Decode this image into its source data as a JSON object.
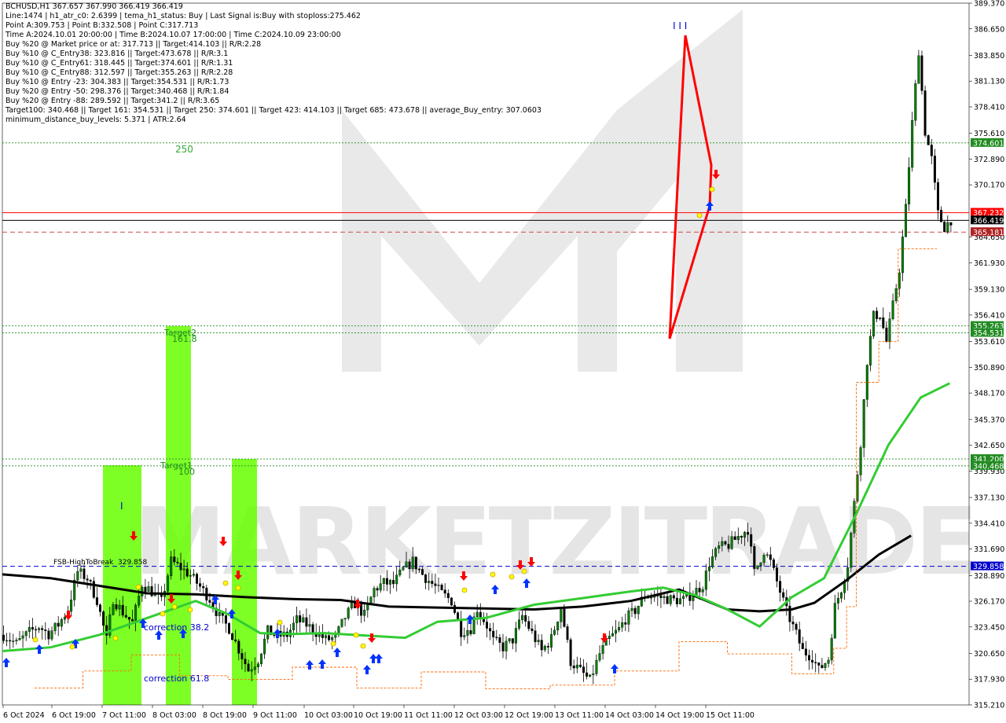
{
  "header": {
    "lines": [
      "BCHUSD,H1  367.657 367.990 366.419 366.419",
      "Line:1474 | h1_atr_c0: 2.6399 | tema_h1_status: Buy | Last Signal is:Buy with stoploss:275.462",
      "Point A:309.753 | Point B:332.508 | Point C:317.713",
      "Time A:2024.10.01 20:00:00 | Time B:2024.10.07 17:00:00 | Time C:2024.10.09 23:00:00",
      "Buy %20 @ Market price or at: 317.713 || Target:414.103 || R/R:2.28",
      "Buy %10 @ C_Entry38: 323.816 || Target:473.678 || R/R:3.1",
      "Buy %10 @ C_Entry61: 318.445 || Target:374.601 || R/R:1.31",
      "Buy %10 @ C_Entry88: 312.597 || Target:355.263 || R/R:2.28",
      "Buy %10 @ Entry -23: 304.383 || Target:354.531 || R/R:1.73",
      "Buy %20 @ Entry -50: 298.376 || Target:340.468 || R/R:1.84",
      "Buy %20 @ Entry -88: 289.592 || Target:341.2 || R/R:3.65",
      "Target100: 340.468 || Target 161: 354.531 || Target 250: 374.601 || Target 423: 414.103 || Target 685: 473.678 || average_Buy_entry: 307.0603",
      "minimum_distance_buy_levels: 5.371 | ATR:2.64"
    ]
  },
  "chart_data": {
    "type": "candlestick",
    "symbol": "BCHUSD",
    "timeframe": "H1",
    "ylim": [
      315.21,
      389.37
    ],
    "y_ticks": [
      389.37,
      386.65,
      383.85,
      381.13,
      378.41,
      375.61,
      372.89,
      370.17,
      364.65,
      361.93,
      359.13,
      356.41,
      353.61,
      350.89,
      348.17,
      345.37,
      342.65,
      339.93,
      337.13,
      334.41,
      331.69,
      328.89,
      326.17,
      323.45,
      320.65,
      317.93,
      315.21
    ],
    "y_tick_labels": [
      "389.370",
      "386.650",
      "383.850",
      "381.130",
      "378.410",
      "375.610",
      "372.890",
      "370.170",
      "364.650",
      "361.930",
      "359.130",
      "356.410",
      "353.610",
      "350.890",
      "348.170",
      "345.370",
      "342.650",
      "339.930",
      "337.130",
      "334.410",
      "331.690",
      "328.890",
      "326.170",
      "323.450",
      "320.650",
      "317.930",
      "315.210"
    ],
    "x_labels": [
      "6 Oct 2024",
      "6 Oct 19:00",
      "7 Oct 11:00",
      "8 Oct 03:00",
      "8 Oct 19:00",
      "9 Oct 11:00",
      "10 Oct 03:00",
      "10 Oct 19:00",
      "11 Oct 11:00",
      "12 Oct 03:00",
      "12 Oct 19:00",
      "13 Oct 11:00",
      "14 Oct 03:00",
      "14 Oct 19:00",
      "15 Oct 11:00"
    ],
    "close_path": [
      [
        0,
        322.6
      ],
      [
        4,
        321.7
      ],
      [
        8,
        322.9
      ],
      [
        11,
        323.5
      ],
      [
        14,
        322.7
      ],
      [
        17,
        323.7
      ],
      [
        20,
        325.3
      ],
      [
        23,
        329.3
      ],
      [
        26,
        328.6
      ],
      [
        29,
        326.3
      ],
      [
        32,
        322.1
      ],
      [
        34,
        326.4
      ],
      [
        37,
        325.0
      ],
      [
        40,
        323.9
      ],
      [
        43,
        328.0
      ],
      [
        46,
        327.2
      ],
      [
        49,
        326.1
      ],
      [
        52,
        330.4
      ],
      [
        55,
        329.7
      ],
      [
        58,
        328.9
      ],
      [
        61,
        327.7
      ],
      [
        64,
        326.4
      ],
      [
        67,
        324.5
      ],
      [
        70,
        323.3
      ],
      [
        73,
        321.1
      ],
      [
        76,
        318.9
      ],
      [
        79,
        320.0
      ],
      [
        82,
        323.0
      ],
      [
        85,
        322.5
      ],
      [
        88,
        322.6
      ],
      [
        91,
        324.2
      ],
      [
        94,
        323.7
      ],
      [
        97,
        322.9
      ],
      [
        100,
        322.1
      ],
      [
        103,
        322.3
      ],
      [
        106,
        324.5
      ],
      [
        109,
        325.9
      ],
      [
        112,
        324.7
      ],
      [
        115,
        327.4
      ],
      [
        118,
        328.1
      ],
      [
        121,
        328.0
      ],
      [
        124,
        329.5
      ],
      [
        127,
        330.4
      ],
      [
        130,
        329.0
      ],
      [
        133,
        328.0
      ],
      [
        136,
        327.0
      ],
      [
        139,
        326.2
      ],
      [
        142,
        323.0
      ],
      [
        145,
        323.3
      ],
      [
        147,
        325.4
      ],
      [
        150,
        323.6
      ],
      [
        152,
        322.0
      ],
      [
        155,
        321.3
      ],
      [
        158,
        322.1
      ],
      [
        161,
        324.6
      ],
      [
        164,
        322.8
      ],
      [
        167,
        320.9
      ],
      [
        170,
        322.2
      ],
      [
        173,
        325.5
      ],
      [
        176,
        319.8
      ],
      [
        179,
        318.8
      ],
      [
        182,
        317.8
      ],
      [
        185,
        320.6
      ],
      [
        188,
        322.2
      ],
      [
        191,
        323.2
      ],
      [
        193,
        324.3
      ],
      [
        196,
        325.2
      ],
      [
        199,
        326.8
      ],
      [
        202,
        326.7
      ],
      [
        205,
        326.5
      ],
      [
        208,
        326.3
      ],
      [
        211,
        326.3
      ],
      [
        214,
        327.0
      ],
      [
        217,
        327.9
      ],
      [
        219,
        330.2
      ],
      [
        222,
        331.8
      ],
      [
        225,
        332.1
      ],
      [
        228,
        333.0
      ],
      [
        231,
        333.8
      ],
      [
        233,
        329.2
      ],
      [
        236,
        331.5
      ],
      [
        238,
        330.3
      ],
      [
        241,
        327.2
      ],
      [
        243,
        325.1
      ],
      [
        246,
        322.7
      ],
      [
        248,
        320.9
      ],
      [
        251,
        320.3
      ],
      [
        253,
        318.9
      ],
      [
        256,
        320.1
      ],
      [
        258,
        325.6
      ],
      [
        260,
        327.5
      ],
      [
        262,
        330.1
      ],
      [
        264,
        336.5
      ],
      [
        266,
        343.0
      ],
      [
        268,
        351.6
      ],
      [
        270,
        356.3
      ],
      [
        272,
        356.5
      ],
      [
        274,
        353.6
      ],
      [
        276,
        357.4
      ],
      [
        278,
        361.3
      ],
      [
        280,
        367.7
      ],
      [
        282,
        376.7
      ],
      [
        284,
        384.4
      ],
      [
        286,
        375.8
      ],
      [
        288,
        372.9
      ],
      [
        290,
        367.1
      ],
      [
        292,
        365.7
      ],
      [
        294,
        366.5
      ]
    ],
    "moving_averages": [
      {
        "color": "#000000",
        "points": [
          [
            0,
            329.0
          ],
          [
            15,
            328.6
          ],
          [
            30,
            327.8
          ],
          [
            45,
            327.0
          ],
          [
            60,
            326.9
          ],
          [
            75,
            326.6
          ],
          [
            90,
            326.4
          ],
          [
            105,
            326.3
          ],
          [
            120,
            325.6
          ],
          [
            135,
            325.5
          ],
          [
            150,
            325.4
          ],
          [
            165,
            325.3
          ],
          [
            180,
            325.6
          ],
          [
            195,
            326.2
          ],
          [
            210,
            327.4
          ],
          [
            225,
            325.3
          ],
          [
            235,
            325.1
          ],
          [
            245,
            325.3
          ],
          [
            252,
            326.0
          ],
          [
            262,
            328.4
          ],
          [
            272,
            331.1
          ],
          [
            282,
            333.1
          ]
        ]
      },
      {
        "color": "#33cc33",
        "points": [
          [
            0,
            320.9
          ],
          [
            15,
            321.3
          ],
          [
            30,
            322.6
          ],
          [
            45,
            324.4
          ],
          [
            60,
            326.2
          ],
          [
            70,
            324.8
          ],
          [
            80,
            322.8
          ],
          [
            90,
            322.7
          ],
          [
            100,
            322.8
          ],
          [
            115,
            322.5
          ],
          [
            125,
            322.3
          ],
          [
            135,
            324.0
          ],
          [
            150,
            324.4
          ],
          [
            165,
            325.8
          ],
          [
            180,
            326.5
          ],
          [
            195,
            327.2
          ],
          [
            205,
            327.6
          ],
          [
            215,
            326.8
          ],
          [
            225,
            325.3
          ],
          [
            235,
            323.5
          ],
          [
            245,
            326.6
          ],
          [
            255,
            328.6
          ],
          [
            265,
            335.4
          ],
          [
            275,
            342.7
          ],
          [
            285,
            347.7
          ],
          [
            294,
            349.2
          ]
        ]
      }
    ],
    "horizontal_lines": [
      {
        "value": 367.232,
        "label": "367.232",
        "color": "#ff0000",
        "style": "solid"
      },
      {
        "value": 366.419,
        "label": "366.419",
        "color": "#000000",
        "style": "solid"
      },
      {
        "value": 365.181,
        "label": "365.181",
        "color": "#cc3333",
        "style": "dashed"
      },
      {
        "value": 374.601,
        "label": "374.601",
        "color": "#228b22",
        "style": "dotted"
      },
      {
        "value": 355.263,
        "label": "355.263",
        "color": "#228b22",
        "style": "dotted"
      },
      {
        "value": 354.531,
        "label": "354.531",
        "color": "#228b22",
        "style": "dotted"
      },
      {
        "value": 341.2,
        "label": "341.200",
        "color": "#228b22",
        "style": "dotted"
      },
      {
        "value": 340.468,
        "label": "340.468",
        "color": "#228b22",
        "style": "dotted"
      },
      {
        "value": 329.858,
        "label": "329.858",
        "color": "#0000cc",
        "style": "dashed"
      }
    ],
    "annotations": [
      {
        "text": "250",
        "color": "#33aa33"
      },
      {
        "text": "Target2",
        "color": "#228b22"
      },
      {
        "text": "161.8",
        "color": "#228b22"
      },
      {
        "text": "Target1",
        "color": "#228b22"
      },
      {
        "text": "100",
        "color": "#228b22"
      },
      {
        "text": "FSB-HighToBreak",
        "color": "#000000"
      },
      {
        "text": "329.858",
        "color": "#000000"
      },
      {
        "text": "correction 38.2",
        "color": "#0000cc"
      },
      {
        "text": "correction 61.8",
        "color": "#0000cc"
      },
      {
        "text": "I I I",
        "color": "#0000cc"
      },
      {
        "text": "I",
        "color": "#0000cc"
      }
    ],
    "watermark": "MARKETZITRADE",
    "colors": {
      "bull": "#008000",
      "bear": "#000000",
      "green_band": "#66ff00",
      "red_line": "#ff0000",
      "axis_label_bg_green": "#228b22"
    }
  }
}
